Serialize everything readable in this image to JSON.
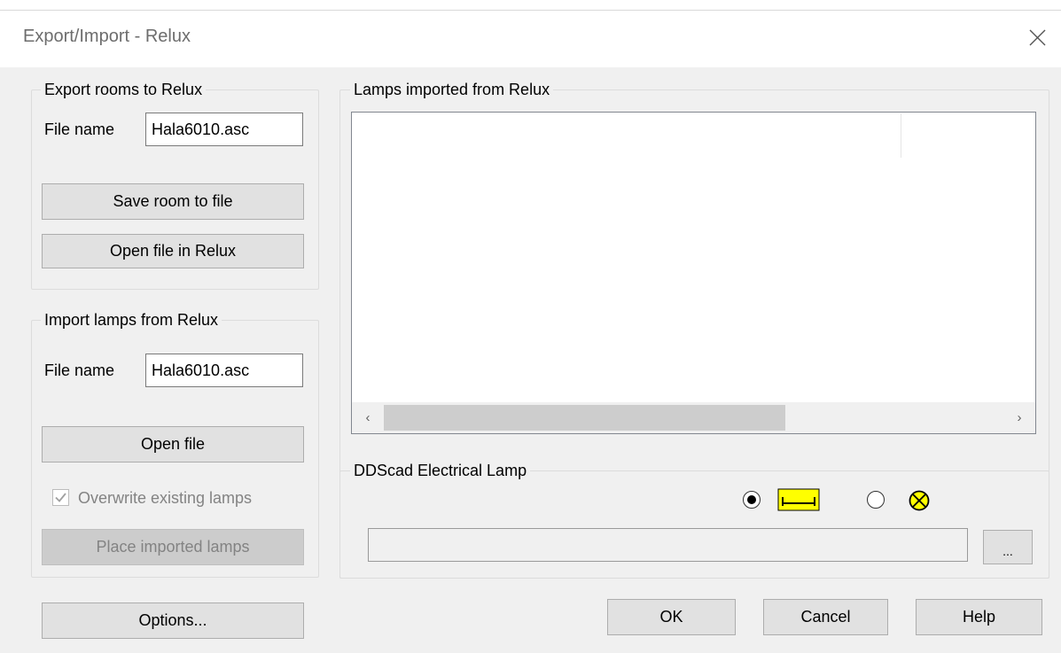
{
  "window": {
    "title": "Export/Import - Relux",
    "close_icon": "close-icon"
  },
  "export_group": {
    "legend": "Export rooms to Relux",
    "file_label": "File name",
    "file_value": "Hala6010.asc",
    "save_button": "Save room to file",
    "open_relux_button": "Open file in Relux"
  },
  "import_group": {
    "legend": "Import lamps from Relux",
    "file_label": "File name",
    "file_value": "Hala6010.asc",
    "open_button": "Open file",
    "overwrite_label": "Overwrite existing lamps",
    "overwrite_checked": true,
    "place_button": "Place imported lamps"
  },
  "lamps_group": {
    "legend": "Lamps imported from Relux",
    "items": [],
    "scroll_left": "‹",
    "scroll_right": "›"
  },
  "electrical_group": {
    "legend": "DDScad Electrical Lamp",
    "selected_type": "fluorescent-tube",
    "symbol_color": "#ffff00",
    "lamp_path_value": "",
    "browse_button": "..."
  },
  "footer": {
    "options_button": "Options...",
    "ok_button": "OK",
    "cancel_button": "Cancel",
    "help_button": "Help"
  }
}
